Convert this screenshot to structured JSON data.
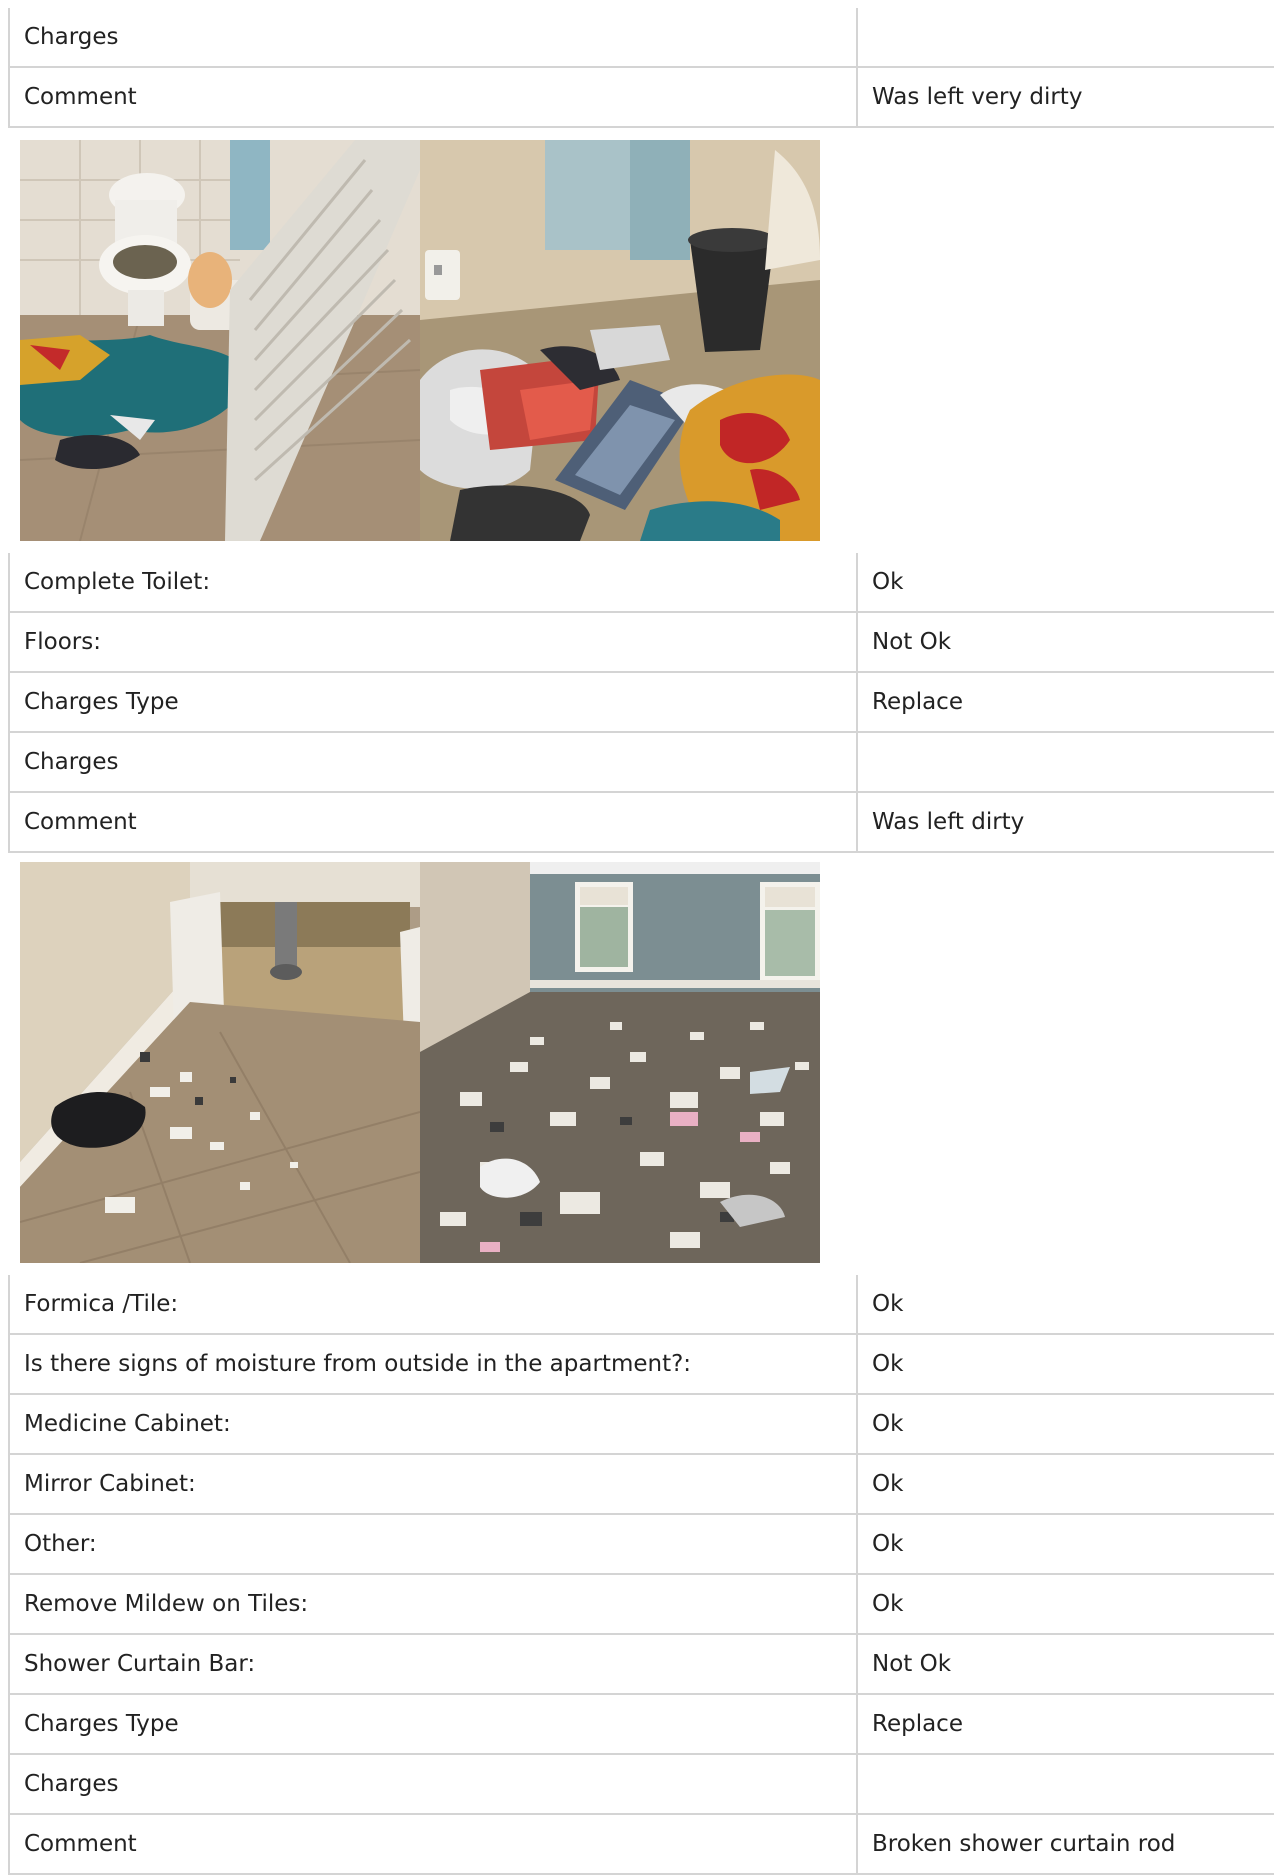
{
  "sections": [
    {
      "rows": [
        {
          "label": "Charges",
          "value": ""
        },
        {
          "label": "Comment",
          "value": "Was left very dirty"
        }
      ]
    },
    {
      "rows": [
        {
          "label": "Complete Toilet:",
          "value": "Ok"
        },
        {
          "label": "Floors:",
          "value": "Not Ok"
        },
        {
          "label": "Charges Type",
          "value": "Replace"
        },
        {
          "label": "Charges",
          "value": ""
        },
        {
          "label": "Comment",
          "value": "Was left dirty"
        }
      ]
    },
    {
      "rows": [
        {
          "label": "Formica /Tile:",
          "value": "Ok"
        },
        {
          "label": "Is there signs of moisture from outside in the apartment?:",
          "value": "Ok"
        },
        {
          "label": "Medicine Cabinet:",
          "value": "Ok"
        },
        {
          "label": "Mirror Cabinet:",
          "value": "Ok"
        },
        {
          "label": "Other:",
          "value": "Ok"
        },
        {
          "label": "Remove Mildew on Tiles:",
          "value": "Ok"
        },
        {
          "label": "Shower Curtain Bar:",
          "value": "Not Ok"
        },
        {
          "label": "Charges Type",
          "value": "Replace"
        },
        {
          "label": "Charges",
          "value": ""
        },
        {
          "label": "Comment",
          "value": "Broken shower curtain rod"
        }
      ]
    }
  ],
  "photo_groups": [
    {
      "photos": [
        "bathroom-toilet-floor-photo",
        "bathroom-trash-pile-photo"
      ]
    },
    {
      "photos": [
        "under-sink-floor-photo",
        "bedroom-littered-floor-photo"
      ]
    }
  ]
}
